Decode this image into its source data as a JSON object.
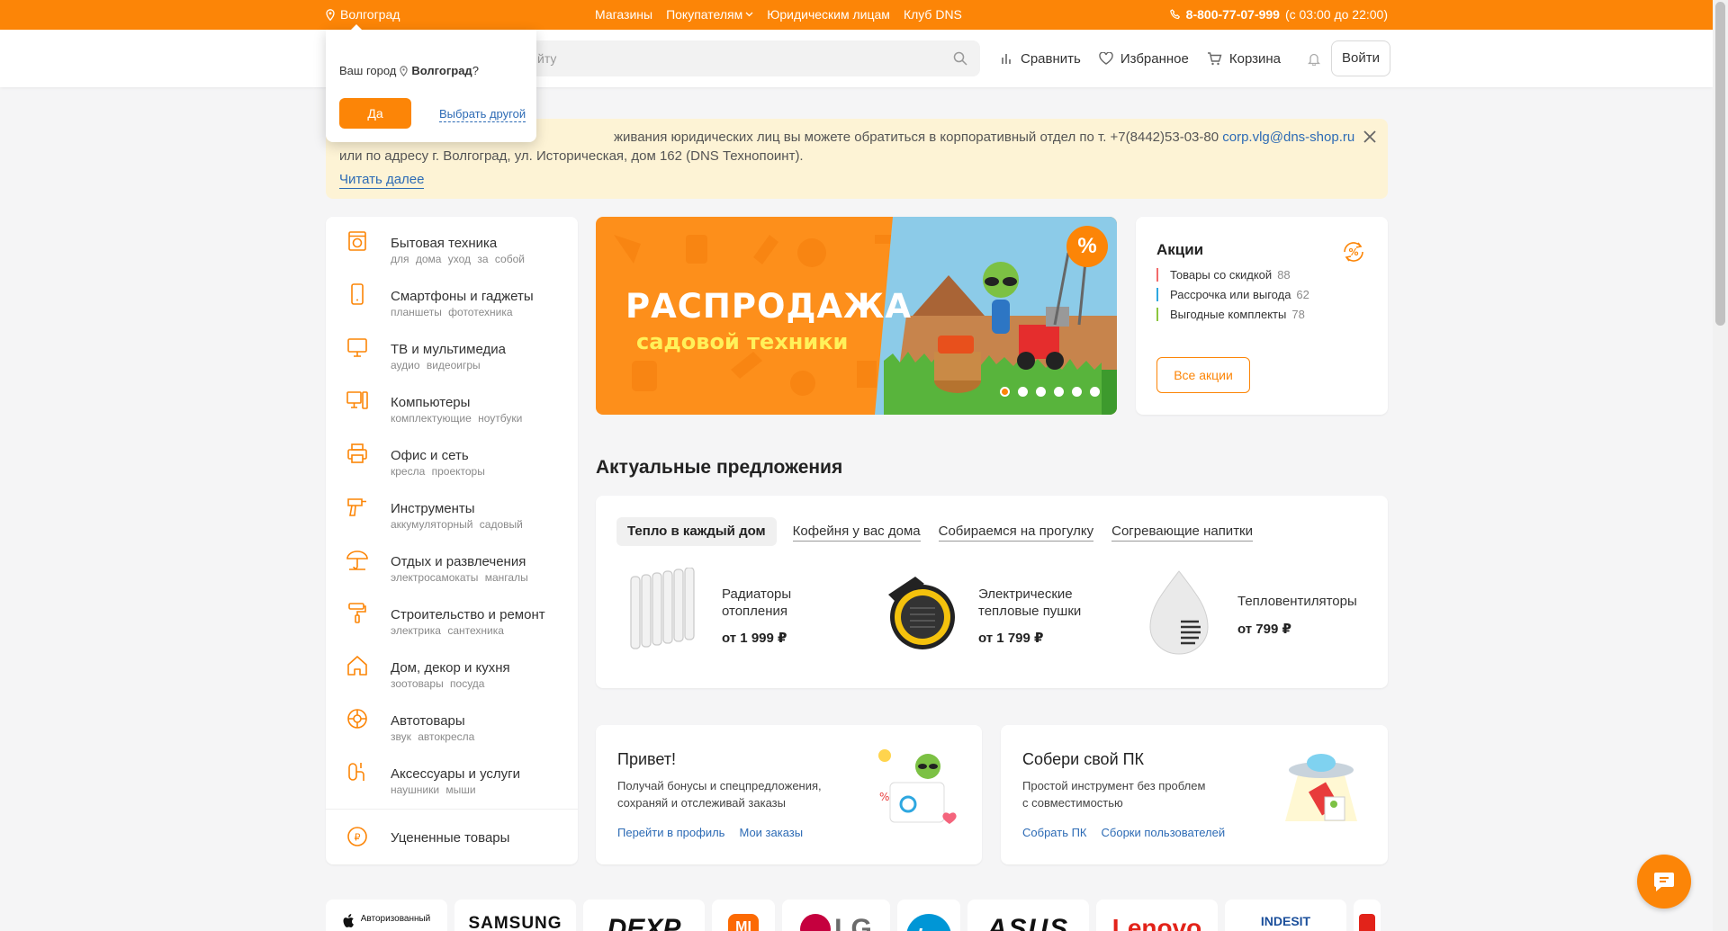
{
  "colors": {
    "accent": "#fc8507",
    "link": "#2d6bb5"
  },
  "topbar": {
    "city": "Волгоград",
    "nav": [
      "Магазины",
      "Покупателям",
      "Юридическим лицам",
      "Клуб DNS"
    ],
    "phone": "8-800-77-07-999",
    "hours": "(с 03:00 до 22:00)"
  },
  "header": {
    "search_placeholder": "йту",
    "actions": [
      "Сравнить",
      "Избранное",
      "Корзина"
    ],
    "login": "Войти"
  },
  "city_popup": {
    "question": "Ваш город",
    "city": "Волгоград",
    "question_mark": "?",
    "yes": "Да",
    "other": "Выбрать другой"
  },
  "notice": {
    "text_before": "живания юридических лиц вы можете обратиться в корпоративный отдел по т. +7(8442)53-03-80",
    "email": "corp.vlg@dns-shop.ru",
    "text_after": "или по адресу г. Волгоград, ул. Историческая, дом 162 (DNS Технопоинт).",
    "more": "Читать далее"
  },
  "catalog": [
    {
      "name": "Бытовая техника",
      "sub": "для дома уход за собой",
      "icon": "washing-machine-icon"
    },
    {
      "name": "Смартфоны и гаджеты",
      "sub": "планшеты фототехника",
      "icon": "smartphone-icon"
    },
    {
      "name": "ТВ и мультимедиа",
      "sub": "аудио видеоигры",
      "icon": "tv-icon"
    },
    {
      "name": "Компьютеры",
      "sub": "комплектующие ноутбуки",
      "icon": "computer-icon"
    },
    {
      "name": "Офис и сеть",
      "sub": "кресла проекторы",
      "icon": "printer-icon"
    },
    {
      "name": "Инструменты",
      "sub": "аккумуляторный садовый",
      "icon": "drill-icon"
    },
    {
      "name": "Отдых и развлечения",
      "sub": "электросамокаты мангалы",
      "icon": "umbrella-icon"
    },
    {
      "name": "Строительство и ремонт",
      "sub": "электрика сантехника",
      "icon": "paint-roller-icon"
    },
    {
      "name": "Дом, декор и кухня",
      "sub": "зоотовары посуда",
      "icon": "house-icon"
    },
    {
      "name": "Автотовары",
      "sub": "звук автокресла",
      "icon": "wheel-icon"
    },
    {
      "name": "Аксессуары и услуги",
      "sub": "наушники мыши",
      "icon": "accessories-icon"
    },
    {
      "name": "Уцененные товары",
      "sub": "",
      "icon": "discount-coin-icon"
    }
  ],
  "banner": {
    "line1": "РАСПРОДАЖА",
    "line2": "садовой техники",
    "badge": "%",
    "slides": 6,
    "active_slide": 1
  },
  "promo": {
    "title": "Акции",
    "items": [
      {
        "label": "Товары со скидкой",
        "count": "88",
        "color": "#f26b6b"
      },
      {
        "label": "Рассрочка или выгода",
        "count": "62",
        "color": "#2ea7e0"
      },
      {
        "label": "Выгодные комплекты",
        "count": "78",
        "color": "#8cc63f"
      }
    ],
    "all": "Все акции"
  },
  "offers": {
    "title": "Актуальные предложения",
    "tabs": [
      "Тепло в каждый дом",
      "Кофейня у вас дома",
      "Собираемся на прогулку",
      "Согревающие напитки"
    ],
    "items": [
      {
        "name1": "Радиаторы",
        "name2": "отопления",
        "price": "от 1 999 ₽"
      },
      {
        "name1": "Электрические",
        "name2": "тепловые пушки",
        "price": "от 1 799 ₽"
      },
      {
        "name1": "Тепловентиляторы",
        "name2": "",
        "price": "от 799 ₽"
      }
    ]
  },
  "profile_card": {
    "title": "Привет!",
    "desc1": "Получай бонусы и спецпредложения,",
    "desc2": "сохраняй и отслеживай заказы",
    "links": [
      "Перейти в профиль",
      "Мои заказы"
    ]
  },
  "pc_card": {
    "title": "Собери свой ПК",
    "desc1": "Простой инструмент без проблем",
    "desc2": "с совместимостью",
    "links": [
      "Собрать ПК",
      "Сборки пользователей"
    ]
  },
  "brands": [
    "Авторизованный",
    "SAMSUNG",
    "DEXP",
    "MI",
    "LG",
    "hp",
    "ASUS",
    "Lenovo",
    "INDESIT"
  ]
}
